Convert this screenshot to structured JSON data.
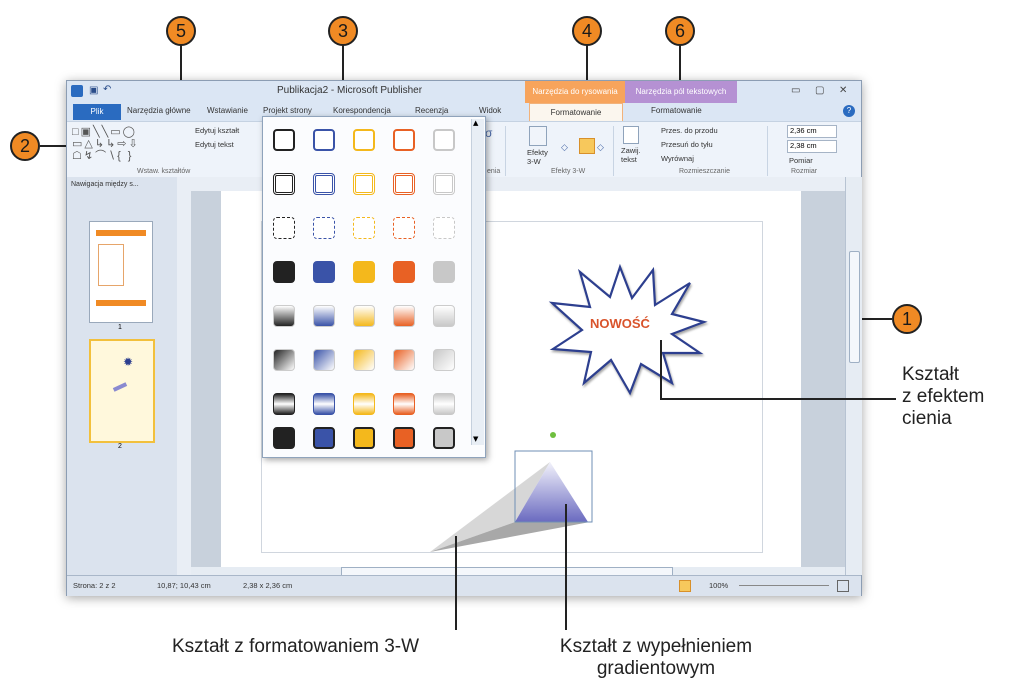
{
  "window": {
    "title": "Publikacja2 - Microsoft Publisher",
    "context_tab_drawing": "Narzędzia do rysowania",
    "context_tab_textbox": "Narzędzia pól tekstowych"
  },
  "tabs": [
    "Plik",
    "Narzędzia główne",
    "Wstawianie",
    "Projekt strony",
    "Korespondencja",
    "Recenzja",
    "Widok",
    "Formatowanie",
    "Formatowanie"
  ],
  "ribbon": {
    "edit_shape": "Edytuj kształt",
    "edit_text": "Edytuj tekst",
    "group_insert_shapes": "Wstaw. kształtów",
    "effects_3d": "Efekty 3-W",
    "effects_3d_button_line1": "Efekty",
    "effects_3d_button_line2": "3-W",
    "effects_3d_group": "Efekty 3-W",
    "wrap_text_line1": "Zawij.",
    "wrap_text_line2": "tekst",
    "bring_forward": "Przes. do przodu",
    "send_backward": "Przesuń do tyłu",
    "align": "Wyrównaj",
    "arrange_group": "Rozmieszczanie",
    "size_group": "Rozmiar",
    "height_value": "2,36 cm",
    "width_value": "2,38 cm",
    "measure_button": "Pomiar",
    "partial_group_label": "enia"
  },
  "navigation": {
    "header": "Nawigacja między s...",
    "page_labels": [
      "1",
      "2"
    ]
  },
  "page_content": {
    "star_text": "NOWOŚĆ"
  },
  "status_bar": {
    "page": "Strona: 2 z 2",
    "position": "10,87; 10,43 cm",
    "size": "2,38 x 2,36 cm",
    "zoom": "100%"
  },
  "callouts": [
    "1",
    "2",
    "3",
    "4",
    "5",
    "6"
  ],
  "captions": {
    "shadow_line1": "Kształt",
    "shadow_line2": "z efektem",
    "shadow_line3": "cienia",
    "three_d": "Kształt z formatowaniem 3-W",
    "gradient_line1": "Kształt z wypełnieniem",
    "gradient_line2": "gradientowym"
  },
  "colors": {
    "callout": "#f08a24",
    "file_tab": "#2a6bc0",
    "drawing_tools": "#f7a45c",
    "textbox_tools": "#b591d3",
    "star_outline": "#2d3f8f",
    "star_text": "#d9532b"
  },
  "gallery_colors": [
    "#222222",
    "#3a53a8",
    "#f4b81c",
    "#e86124",
    "#c8c8c8"
  ]
}
